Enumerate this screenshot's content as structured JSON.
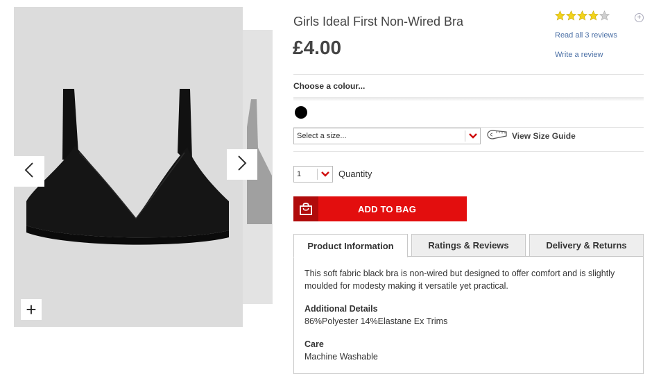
{
  "product": {
    "title": "Girls Ideal First Non-Wired Bra",
    "price": "£4.00",
    "rating": 4,
    "rating_max": 5,
    "read_reviews_label": "Read all 3 reviews",
    "write_review_label": "Write a review"
  },
  "colour": {
    "label": "Choose a colour...",
    "swatches": [
      "#000000"
    ]
  },
  "size": {
    "placeholder": "Select a size...",
    "guide_label": "View Size Guide"
  },
  "quantity": {
    "value": "1",
    "label": "Quantity"
  },
  "add_to_bag": {
    "label": "ADD TO BAG"
  },
  "tabs": [
    {
      "label": "Product Information"
    },
    {
      "label": "Ratings & Reviews"
    },
    {
      "label": "Delivery & Returns"
    }
  ],
  "info": {
    "description": "This soft fabric black bra is non-wired but designed to offer comfort and is slightly moulded for modesty making it versatile yet practical.",
    "additional_heading": "Additional Details",
    "additional_text": "86%Polyester 14%Elastane Ex Trims",
    "care_heading": "Care",
    "care_text": "Machine Washable"
  },
  "gallery": {
    "zoom_label": "+"
  },
  "colors": {
    "accent_red": "#e30e0e",
    "star_yellow": "#f2d31b",
    "link_blue": "#4a6fa5"
  }
}
